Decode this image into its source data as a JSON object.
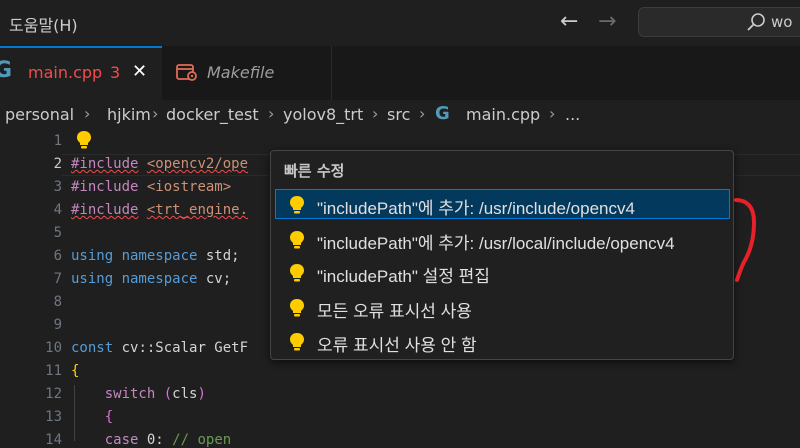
{
  "menu": {
    "help_label": "도움말(H)"
  },
  "search": {
    "text": "wo"
  },
  "tabs": [
    {
      "label": "main.cpp",
      "problem_count": "3",
      "close": "✕",
      "icon": "C++"
    },
    {
      "label": "Makefile",
      "icon": "makefile-icon"
    }
  ],
  "breadcrumb": [
    "personal",
    "hjkim",
    "docker_test",
    "yolov8_trt",
    "src",
    "main.cpp",
    "..."
  ],
  "editor": {
    "line_numbers": [
      "1",
      "2",
      "3",
      "4",
      "5",
      "6",
      "7",
      "8",
      "9",
      "10",
      "11",
      "12",
      "13",
      "14"
    ],
    "lines": {
      "l2_dir": "#include",
      "l2_str": "<opencv2/ope",
      "l3_dir": "#include",
      "l3_str": "<iostream>",
      "l4_dir": "#include",
      "l4_str": "<trt_engine.",
      "l6_kw": "using namespace",
      "l6_id": "std;",
      "l7_kw": "using namespace",
      "l7_id": "cv;",
      "l10_kw": "const",
      "l10_id": "cv::Scalar GetF",
      "l11": "{",
      "l12_kw": "switch",
      "l12_open": "(",
      "l12_id": "cls",
      "l12_close": ")",
      "l13": "{",
      "l14_kw": "case",
      "l14_num": "0:",
      "l14_cmt": "// open"
    }
  },
  "quick_fix": {
    "title": "빠른 수정",
    "items": [
      "\"includePath\"에 추가: /usr/include/opencv4",
      "\"includePath\"에 추가: /usr/local/include/opencv4",
      "\"includePath\" 설정 편집",
      "모든 오류 표시선 사용",
      "오류 표시선 사용 안 함"
    ]
  },
  "colors": {
    "accent": "#0078d4",
    "error": "#f14c4c",
    "bulb": "#ffcc00",
    "annotation": "#e8202a"
  }
}
